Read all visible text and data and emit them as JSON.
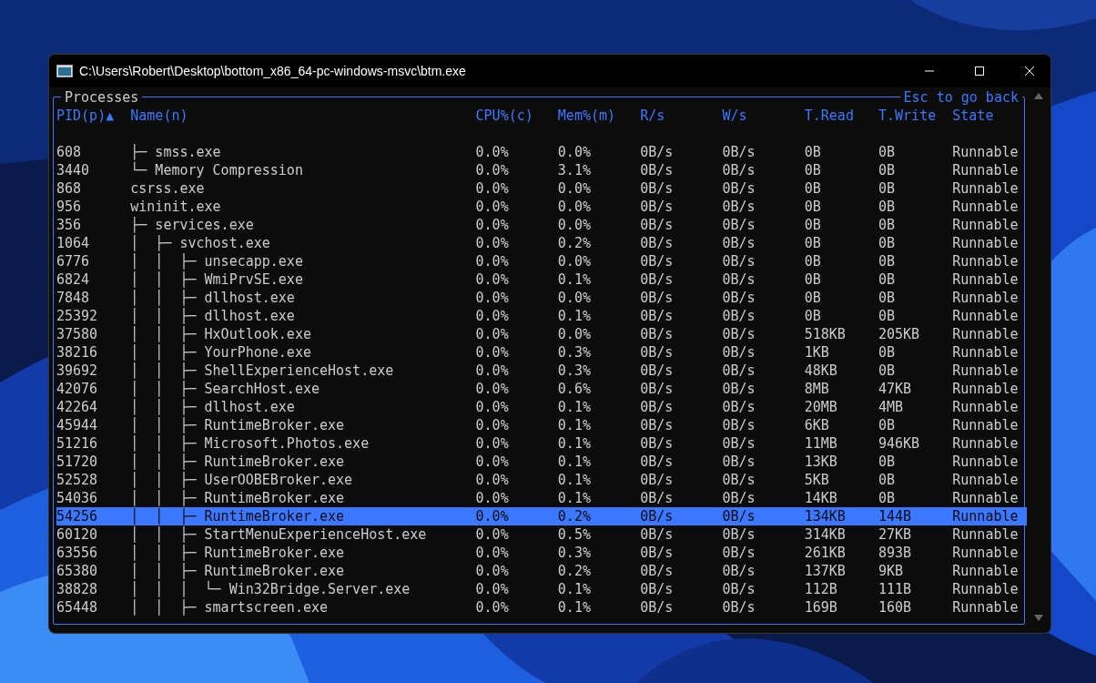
{
  "window": {
    "title": "C:\\Users\\Robert\\Desktop\\bottom_x86_64-pc-windows-msvc\\btm.exe"
  },
  "panel": {
    "title": "Processes",
    "hint": "Esc to go back"
  },
  "columns": [
    "PID(p)▲",
    "Name(n)",
    "CPU%(c)",
    "Mem%(m)",
    "R/s",
    "W/s",
    "T.Read",
    "T.Write",
    "State"
  ],
  "rows": [
    {
      "cells": [
        "608",
        "├─ smss.exe",
        "0.0%",
        "0.0%",
        "0B/s",
        "0B/s",
        "0B",
        "0B",
        "Runnable"
      ],
      "selected": false
    },
    {
      "cells": [
        "3440",
        "└─ Memory Compression",
        "0.0%",
        "3.1%",
        "0B/s",
        "0B/s",
        "0B",
        "0B",
        "Runnable"
      ],
      "selected": false
    },
    {
      "cells": [
        "868",
        "csrss.exe",
        "0.0%",
        "0.0%",
        "0B/s",
        "0B/s",
        "0B",
        "0B",
        "Runnable"
      ],
      "selected": false
    },
    {
      "cells": [
        "956",
        "wininit.exe",
        "0.0%",
        "0.0%",
        "0B/s",
        "0B/s",
        "0B",
        "0B",
        "Runnable"
      ],
      "selected": false
    },
    {
      "cells": [
        "356",
        "├─ services.exe",
        "0.0%",
        "0.0%",
        "0B/s",
        "0B/s",
        "0B",
        "0B",
        "Runnable"
      ],
      "selected": false
    },
    {
      "cells": [
        "1064",
        "│  ├─ svchost.exe",
        "0.0%",
        "0.2%",
        "0B/s",
        "0B/s",
        "0B",
        "0B",
        "Runnable"
      ],
      "selected": false
    },
    {
      "cells": [
        "6776",
        "│  │  ├─ unsecapp.exe",
        "0.0%",
        "0.0%",
        "0B/s",
        "0B/s",
        "0B",
        "0B",
        "Runnable"
      ],
      "selected": false
    },
    {
      "cells": [
        "6824",
        "│  │  ├─ WmiPrvSE.exe",
        "0.0%",
        "0.1%",
        "0B/s",
        "0B/s",
        "0B",
        "0B",
        "Runnable"
      ],
      "selected": false
    },
    {
      "cells": [
        "7848",
        "│  │  ├─ dllhost.exe",
        "0.0%",
        "0.0%",
        "0B/s",
        "0B/s",
        "0B",
        "0B",
        "Runnable"
      ],
      "selected": false
    },
    {
      "cells": [
        "25392",
        "│  │  ├─ dllhost.exe",
        "0.0%",
        "0.1%",
        "0B/s",
        "0B/s",
        "0B",
        "0B",
        "Runnable"
      ],
      "selected": false
    },
    {
      "cells": [
        "37580",
        "│  │  ├─ HxOutlook.exe",
        "0.0%",
        "0.0%",
        "0B/s",
        "0B/s",
        "518KB",
        "205KB",
        "Runnable"
      ],
      "selected": false
    },
    {
      "cells": [
        "38216",
        "│  │  ├─ YourPhone.exe",
        "0.0%",
        "0.3%",
        "0B/s",
        "0B/s",
        "1KB",
        "0B",
        "Runnable"
      ],
      "selected": false
    },
    {
      "cells": [
        "39692",
        "│  │  ├─ ShellExperienceHost.exe",
        "0.0%",
        "0.3%",
        "0B/s",
        "0B/s",
        "48KB",
        "0B",
        "Runnable"
      ],
      "selected": false
    },
    {
      "cells": [
        "42076",
        "│  │  ├─ SearchHost.exe",
        "0.0%",
        "0.6%",
        "0B/s",
        "0B/s",
        "8MB",
        "47KB",
        "Runnable"
      ],
      "selected": false
    },
    {
      "cells": [
        "42264",
        "│  │  ├─ dllhost.exe",
        "0.0%",
        "0.1%",
        "0B/s",
        "0B/s",
        "20MB",
        "4MB",
        "Runnable"
      ],
      "selected": false
    },
    {
      "cells": [
        "45944",
        "│  │  ├─ RuntimeBroker.exe",
        "0.0%",
        "0.1%",
        "0B/s",
        "0B/s",
        "6KB",
        "0B",
        "Runnable"
      ],
      "selected": false
    },
    {
      "cells": [
        "51216",
        "│  │  ├─ Microsoft.Photos.exe",
        "0.0%",
        "0.1%",
        "0B/s",
        "0B/s",
        "11MB",
        "946KB",
        "Runnable"
      ],
      "selected": false
    },
    {
      "cells": [
        "51720",
        "│  │  ├─ RuntimeBroker.exe",
        "0.0%",
        "0.1%",
        "0B/s",
        "0B/s",
        "13KB",
        "0B",
        "Runnable"
      ],
      "selected": false
    },
    {
      "cells": [
        "52528",
        "│  │  ├─ UserOOBEBroker.exe",
        "0.0%",
        "0.1%",
        "0B/s",
        "0B/s",
        "5KB",
        "0B",
        "Runnable"
      ],
      "selected": false
    },
    {
      "cells": [
        "54036",
        "│  │  ├─ RuntimeBroker.exe",
        "0.0%",
        "0.1%",
        "0B/s",
        "0B/s",
        "14KB",
        "0B",
        "Runnable"
      ],
      "selected": false
    },
    {
      "cells": [
        "54256",
        "│  │  ├─ RuntimeBroker.exe",
        "0.0%",
        "0.2%",
        "0B/s",
        "0B/s",
        "134KB",
        "144B",
        "Runnable"
      ],
      "selected": true
    },
    {
      "cells": [
        "60120",
        "│  │  ├─ StartMenuExperienceHost.exe",
        "0.0%",
        "0.5%",
        "0B/s",
        "0B/s",
        "314KB",
        "27KB",
        "Runnable"
      ],
      "selected": false
    },
    {
      "cells": [
        "63556",
        "│  │  ├─ RuntimeBroker.exe",
        "0.0%",
        "0.3%",
        "0B/s",
        "0B/s",
        "261KB",
        "893B",
        "Runnable"
      ],
      "selected": false
    },
    {
      "cells": [
        "65380",
        "│  │  ├─ RuntimeBroker.exe",
        "0.0%",
        "0.2%",
        "0B/s",
        "0B/s",
        "137KB",
        "9KB",
        "Runnable"
      ],
      "selected": false
    },
    {
      "cells": [
        "38828",
        "│  │  │  └─ Win32Bridge.Server.exe",
        "0.0%",
        "0.1%",
        "0B/s",
        "0B/s",
        "112B",
        "111B",
        "Runnable"
      ],
      "selected": false
    },
    {
      "cells": [
        "65448",
        "│  │  ├─ smartscreen.exe",
        "0.0%",
        "0.1%",
        "0B/s",
        "0B/s",
        "169B",
        "160B",
        "Runnable"
      ],
      "selected": false
    }
  ]
}
